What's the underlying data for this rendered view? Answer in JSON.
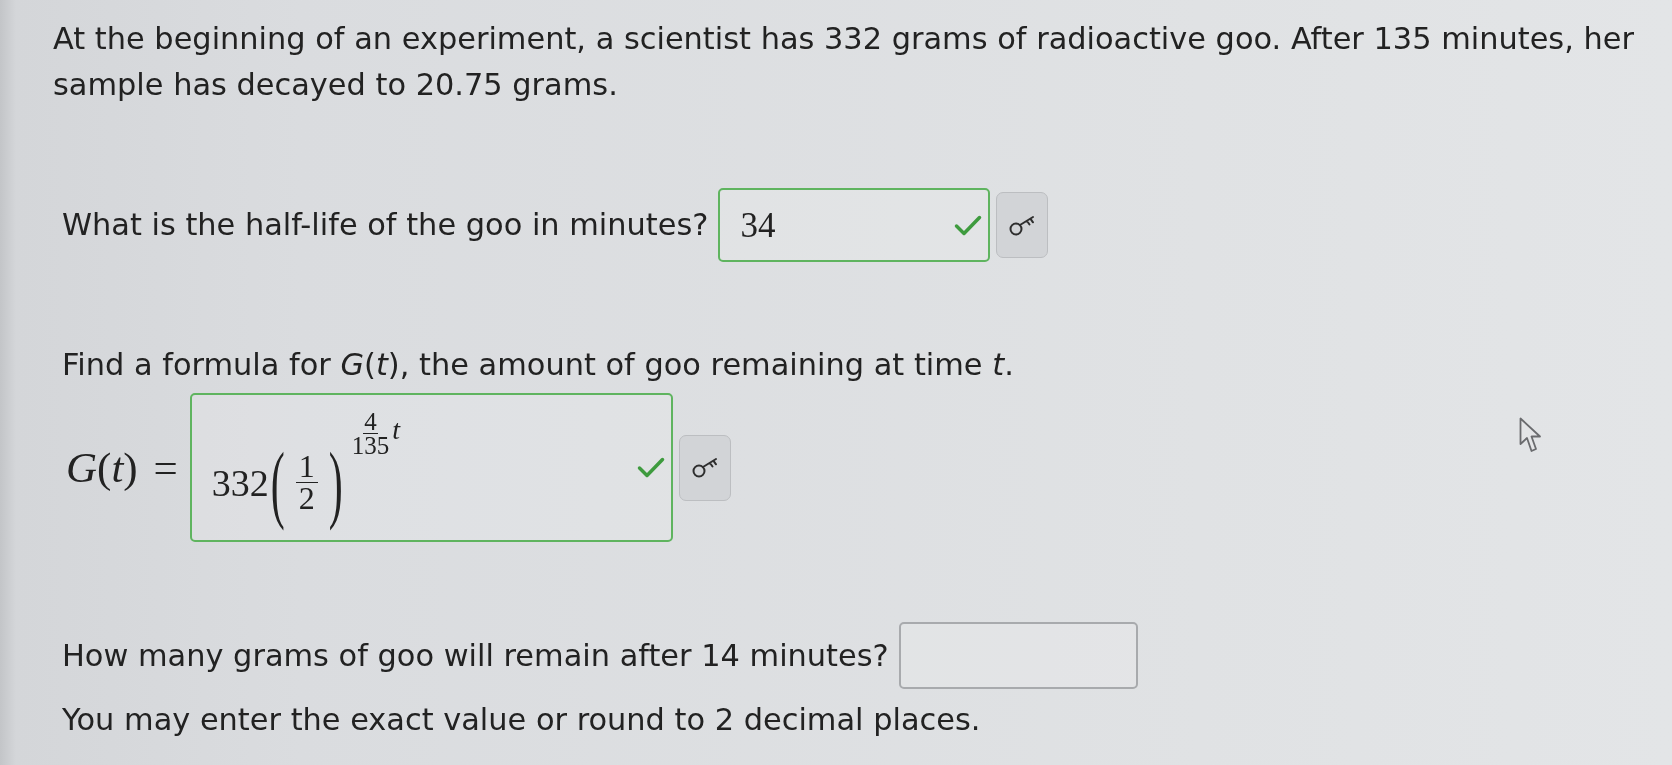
{
  "problem": {
    "text": "At the beginning of an experiment, a scientist has 332 grams of radioactive goo. After 135 minutes, her sample has decayed to 20.75 grams."
  },
  "parts": [
    {
      "kind": "short",
      "prompt": "What is the half-life of the goo in minutes?",
      "answer": {
        "value": "34",
        "correct": true
      },
      "key_button": true
    },
    {
      "kind": "formula",
      "prompt": "Find a formula for *G*(*t*), the amount of goo remaining at time *t*.",
      "equation_label": "*G*(*t*) =",
      "answer": {
        "coefficient": "332",
        "open_paren": "(",
        "base_numerator": "1",
        "base_denominator": "2",
        "close_paren": ")",
        "exponent_numerator": "4",
        "exponent_denominator": "135",
        "exponent_variable": "t",
        "correct": true
      },
      "key_button": true
    },
    {
      "kind": "short",
      "prompt": "How many grams of goo will remain after 14 minutes?",
      "answer": {
        "correct": false
      },
      "note": "You may enter the exact value or round to 2 decimal places."
    }
  ]
}
